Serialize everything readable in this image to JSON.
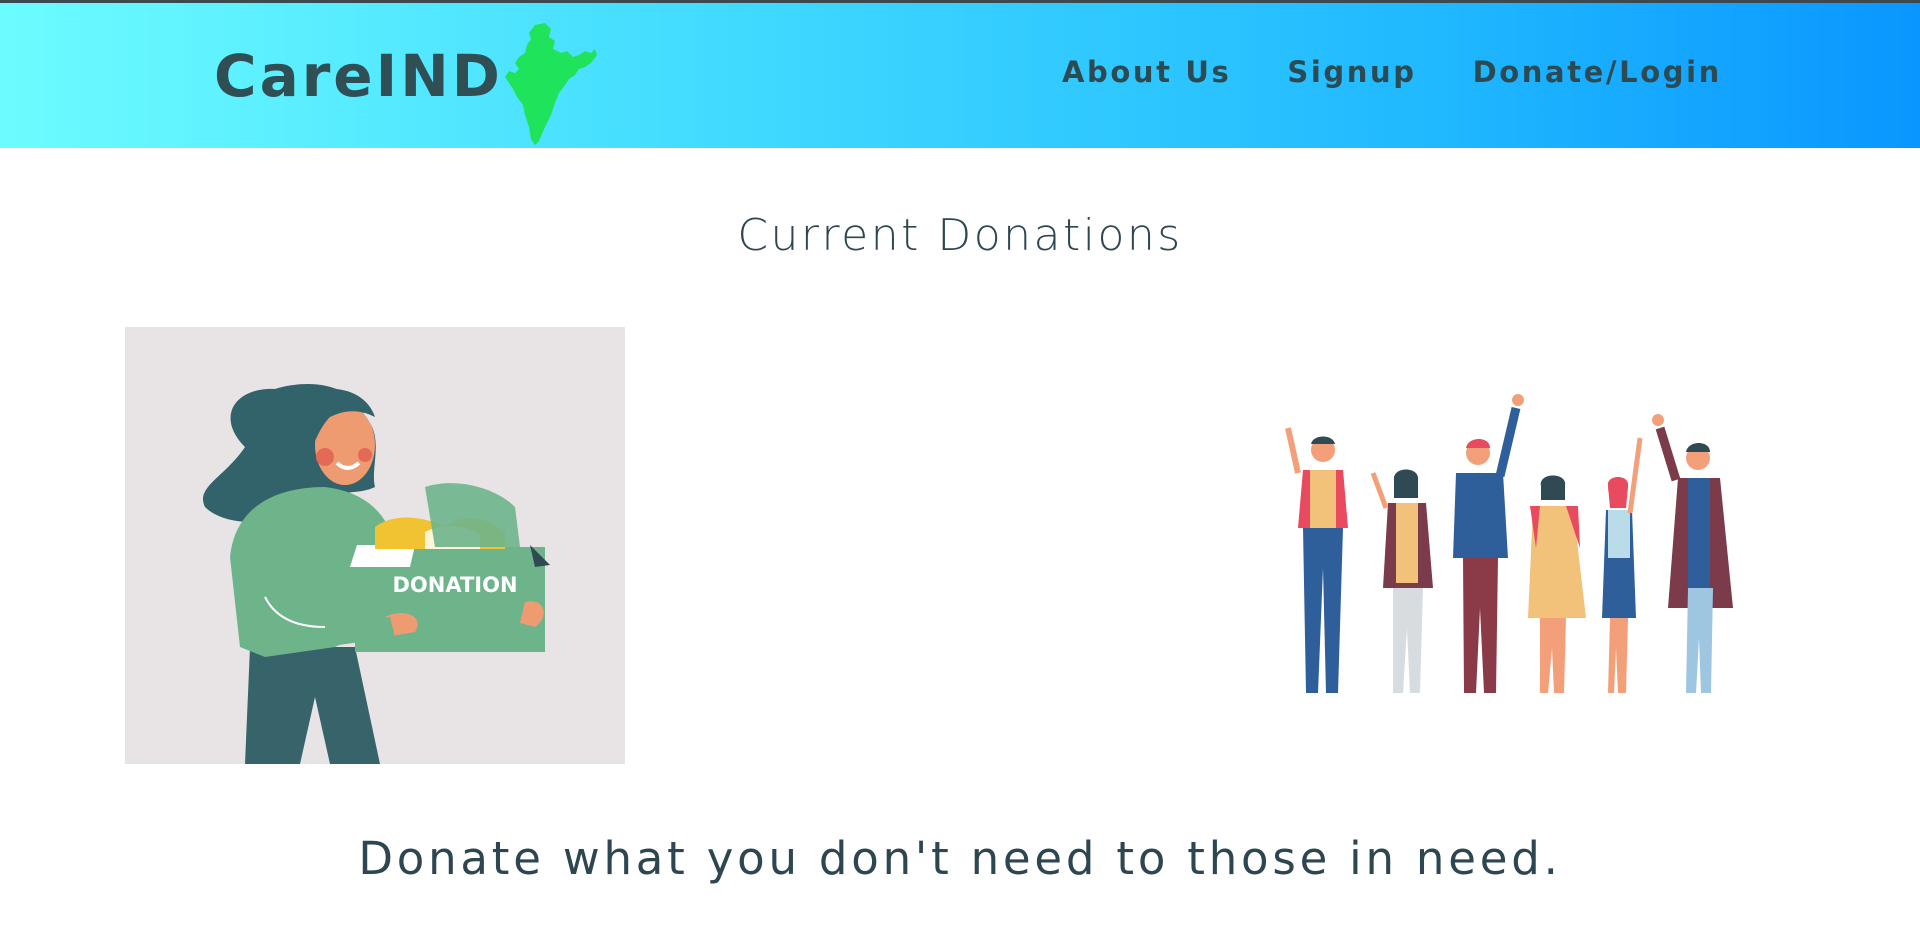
{
  "brand": {
    "name": "CareIND",
    "icon": "india-map-icon",
    "icon_color": "#1fe35b"
  },
  "nav": {
    "items": [
      {
        "label": "About Us"
      },
      {
        "label": "Signup"
      },
      {
        "label": "Donate/Login"
      }
    ]
  },
  "main": {
    "title": "Current Donations",
    "left_image": {
      "icon": "donation-illustration",
      "box_label": "DONATION"
    },
    "right_image": {
      "icon": "waving-people-illustration"
    },
    "tagline": "Donate what you don't need to those in need."
  },
  "colors": {
    "navbar_gradient_start": "#6cfcff",
    "navbar_gradient_end": "#0a96ff",
    "text_dark": "#2d4650"
  }
}
